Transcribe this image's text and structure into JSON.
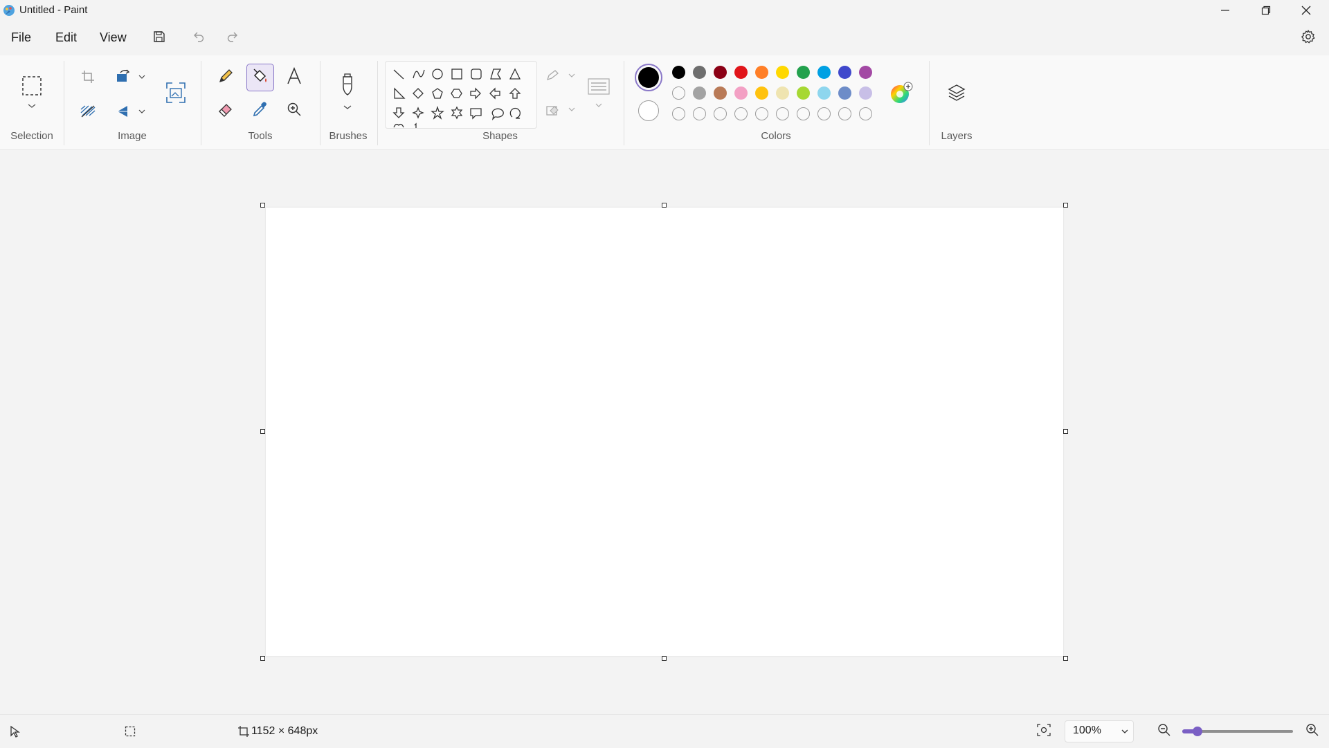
{
  "window": {
    "title": "Untitled - Paint"
  },
  "menu": {
    "file": "File",
    "edit": "Edit",
    "view": "View"
  },
  "ribbon": {
    "groups": {
      "selection": "Selection",
      "image": "Image",
      "tools": "Tools",
      "brushes": "Brushes",
      "shapes": "Shapes",
      "colors": "Colors",
      "layers": "Layers"
    },
    "active_tool": "fill-icon",
    "colors": {
      "primary": "#000000",
      "secondary": "#ffffff",
      "row1": [
        "#000000",
        "#6e6e6e",
        "#8b0015",
        "#e1151a",
        "#ff7f27",
        "#ffd800",
        "#23a14d",
        "#00a0e3",
        "#3f48cc",
        "#a349a4"
      ],
      "row2": [
        "empty",
        "#a3a3a3",
        "#b97a57",
        "#f3a0c4",
        "#ffc20e",
        "#efe4b0",
        "#a6d833",
        "#8ed6ee",
        "#6d8cc8",
        "#c8bfe7"
      ],
      "row3": [
        "empty",
        "empty",
        "empty",
        "empty",
        "empty",
        "empty",
        "empty",
        "empty",
        "empty",
        "empty"
      ]
    }
  },
  "status": {
    "canvas_size": "1152 × 648px",
    "zoom": "100%",
    "zoom_level": 0.14
  }
}
